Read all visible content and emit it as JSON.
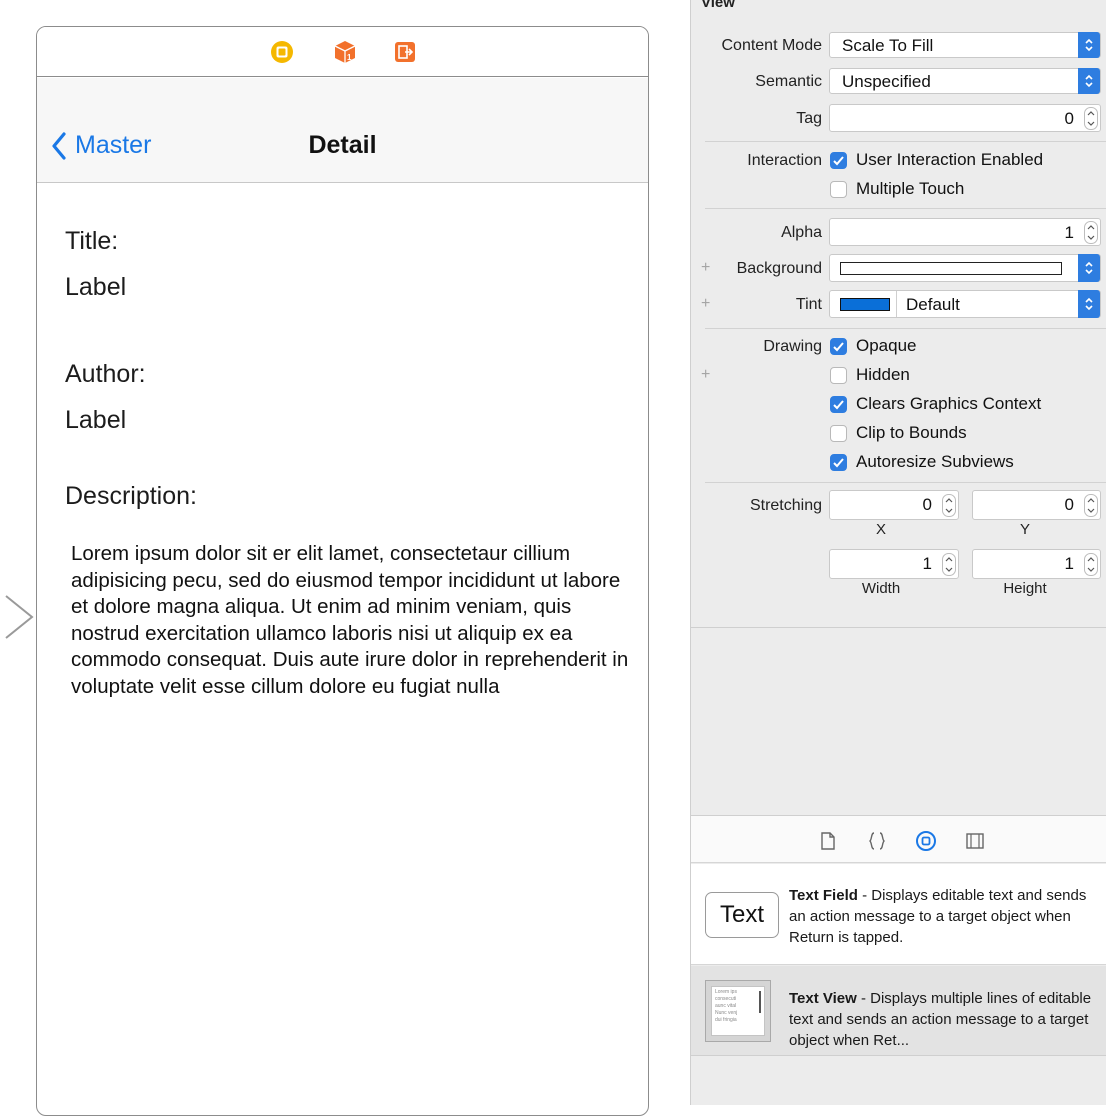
{
  "canvas": {
    "scene_dock": {
      "icons": [
        "view-controller-icon",
        "first-responder-icon",
        "exit-icon"
      ],
      "colors": {
        "view_controller": "#f5b800",
        "first_responder": "#f2712c",
        "exit": "#f2712c"
      }
    },
    "nav_bar": {
      "back_label": "Master",
      "title": "Detail"
    },
    "labels": {
      "title_caption": "Title:",
      "title_value": "Label",
      "author_caption": "Author:",
      "author_value": "Label",
      "description_caption": "Description:"
    },
    "description_text": "Lorem ipsum dolor sit er elit lamet, consectetaur cillium adipisicing pecu, sed do eiusmod tempor incididunt ut labore et dolore magna aliqua. Ut enim ad minim veniam, quis nostrud exercitation ullamco laboris nisi ut aliquip ex ea commodo consequat. Duis aute irure dolor in reprehenderit in voluptate velit esse cillum dolore eu fugiat nulla",
    "accent_color": "#1a78e6"
  },
  "inspector": {
    "section_title": "View",
    "content_mode": {
      "label": "Content Mode",
      "value": "Scale To Fill"
    },
    "semantic": {
      "label": "Semantic",
      "value": "Unspecified"
    },
    "tag": {
      "label": "Tag",
      "value": "0"
    },
    "interaction": {
      "label": "Interaction",
      "options": [
        {
          "label": "User Interaction Enabled",
          "checked": true
        },
        {
          "label": "Multiple Touch",
          "checked": false
        }
      ]
    },
    "alpha": {
      "label": "Alpha",
      "value": "1"
    },
    "background": {
      "label": "Background",
      "color": "#ffffff"
    },
    "tint": {
      "label": "Tint",
      "value": "Default",
      "color": "#0a6fd8"
    },
    "drawing": {
      "label": "Drawing",
      "options": [
        {
          "label": "Opaque",
          "checked": true
        },
        {
          "label": "Hidden",
          "checked": false
        },
        {
          "label": "Clears Graphics Context",
          "checked": true
        },
        {
          "label": "Clip to Bounds",
          "checked": false
        },
        {
          "label": "Autoresize Subviews",
          "checked": true
        }
      ]
    },
    "stretching": {
      "label": "Stretching",
      "x": {
        "value": "0",
        "caption": "X"
      },
      "y": {
        "value": "0",
        "caption": "Y"
      },
      "width": {
        "value": "1",
        "caption": "Width"
      },
      "height": {
        "value": "1",
        "caption": "Height"
      }
    },
    "accent_color": "#2e7de0"
  },
  "library": {
    "tabs": [
      "file-icon",
      "braces-icon",
      "object-icon",
      "media-icon"
    ],
    "items": [
      {
        "preview": "Text",
        "name": "Text Field",
        "description": " - Displays editable text and sends an action message to a target object when Return is tapped."
      },
      {
        "preview_lines": [
          "Lorem ips",
          "consecuti",
          "aunc vital",
          "Nunc venj",
          "dui fringia"
        ],
        "name": "Text View",
        "description": " - Displays multiple lines of editable text and sends an action message to a target object when Ret..."
      }
    ]
  }
}
